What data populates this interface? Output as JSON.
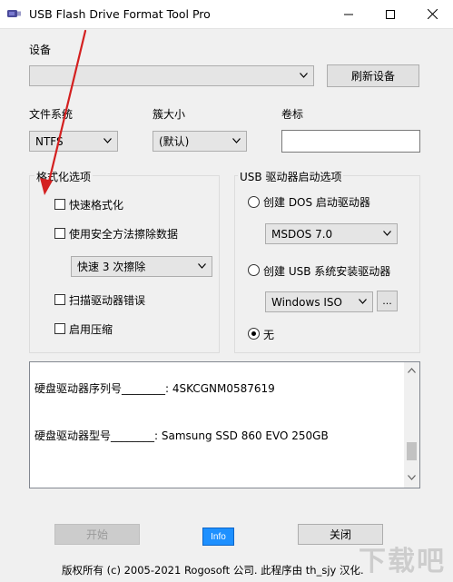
{
  "window": {
    "title": "USB Flash Drive Format Tool Pro"
  },
  "device": {
    "label": "设备",
    "value": "",
    "refresh_label": "刷新设备"
  },
  "filesystem": {
    "label": "文件系统",
    "value": "NTFS"
  },
  "cluster": {
    "label": "簇大小",
    "value": "(默认)"
  },
  "volume": {
    "label": "卷标",
    "value": ""
  },
  "format_options": {
    "title": "格式化选项",
    "quick_format": "快速格式化",
    "secure_erase": "使用安全方法擦除数据",
    "erase_mode": "快速 3 次擦除",
    "scan_errors": "扫描驱动器错误",
    "compression": "启用压缩"
  },
  "boot_options": {
    "title": "USB 驱动器启动选项",
    "dos_label": "创建 DOS 启动驱动器",
    "dos_value": "MSDOS 7.0",
    "usb_install_label": "创建 USB 系统安装驱动器",
    "usb_install_value": "Windows ISO",
    "browse_label": "...",
    "none_label": "无",
    "selected": "none"
  },
  "info": {
    "serial_line": "硬盘驱动器序列号________: 4SKCGNM0587619",
    "model_line": "硬盘驱动器型号________: Samsung SSD 860 EVO 250GB"
  },
  "buttons": {
    "start": "开始",
    "info": "Info",
    "close": "关闭"
  },
  "footer": {
    "copyright": "版权所有 (c) 2005-2021 Rogosoft 公司.   此程序由 th_sjy 汉化."
  },
  "watermark": {
    "text": "下载吧"
  },
  "colors": {
    "annotation_arrow": "#d42020",
    "info_badge": "#1e90ff"
  }
}
